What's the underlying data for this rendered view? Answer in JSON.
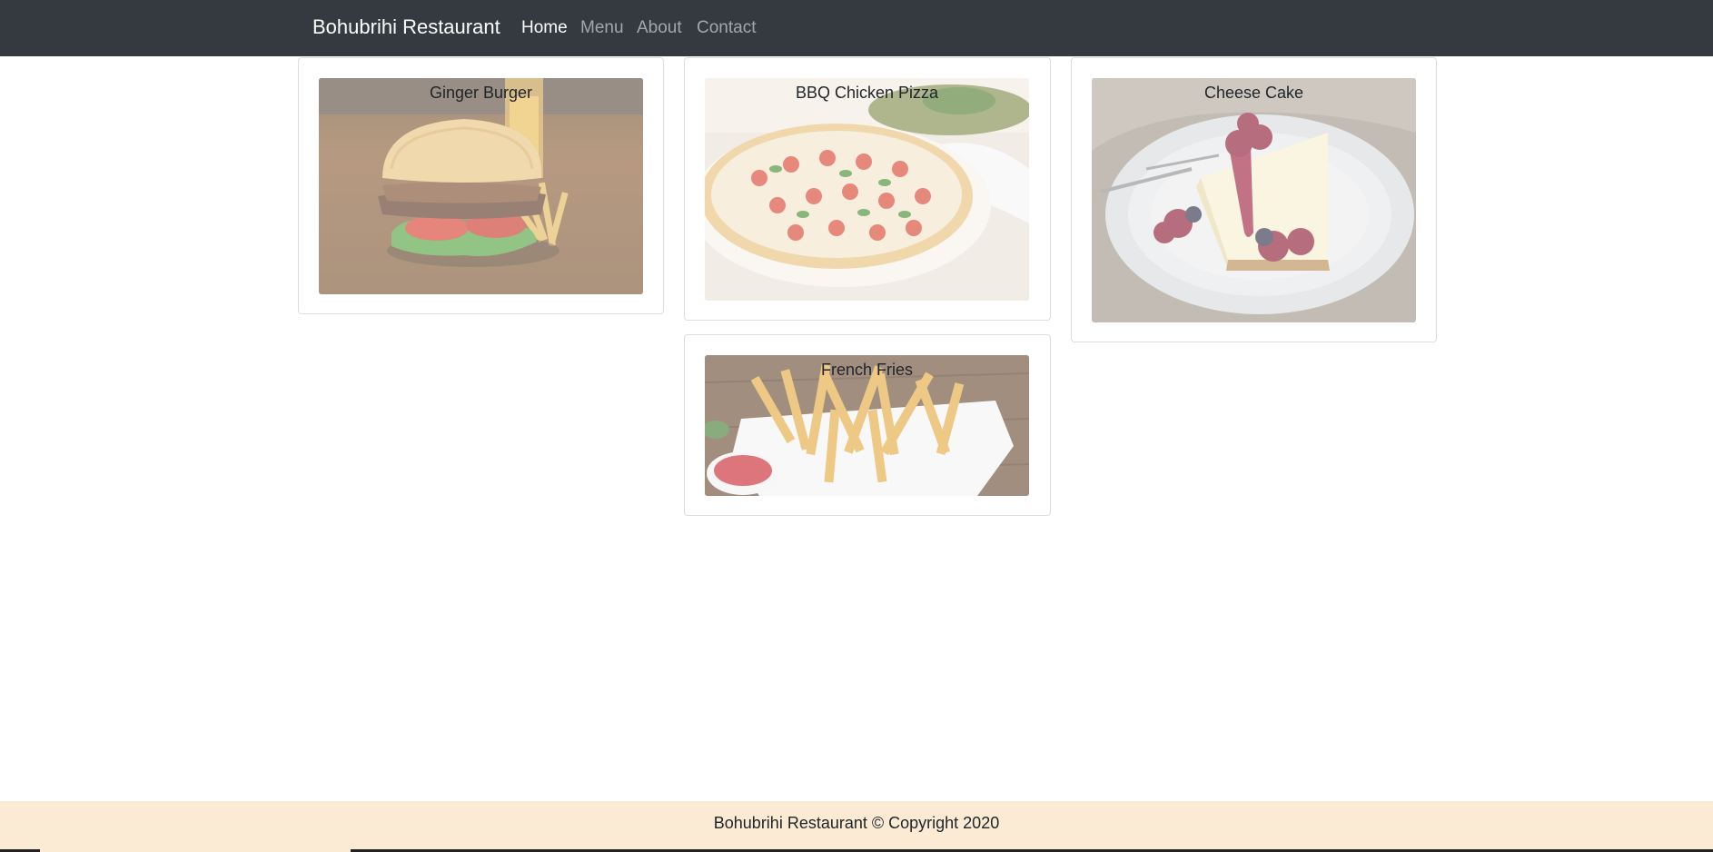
{
  "navbar": {
    "brand": "Bohubrihi Restaurant",
    "links": [
      "Home",
      "Menu",
      "About",
      "Contact"
    ],
    "active": "Home",
    "background": "#343a40"
  },
  "dishes": [
    {
      "name": "Ginger Burger"
    },
    {
      "name": "BBQ Chicken Pizza"
    },
    {
      "name": "Cheese Cake"
    },
    {
      "name": "French Fries"
    }
  ],
  "footer": {
    "text": "Bohubrihi Restaurant © Copyright 2020",
    "background": "#fbebd4"
  }
}
